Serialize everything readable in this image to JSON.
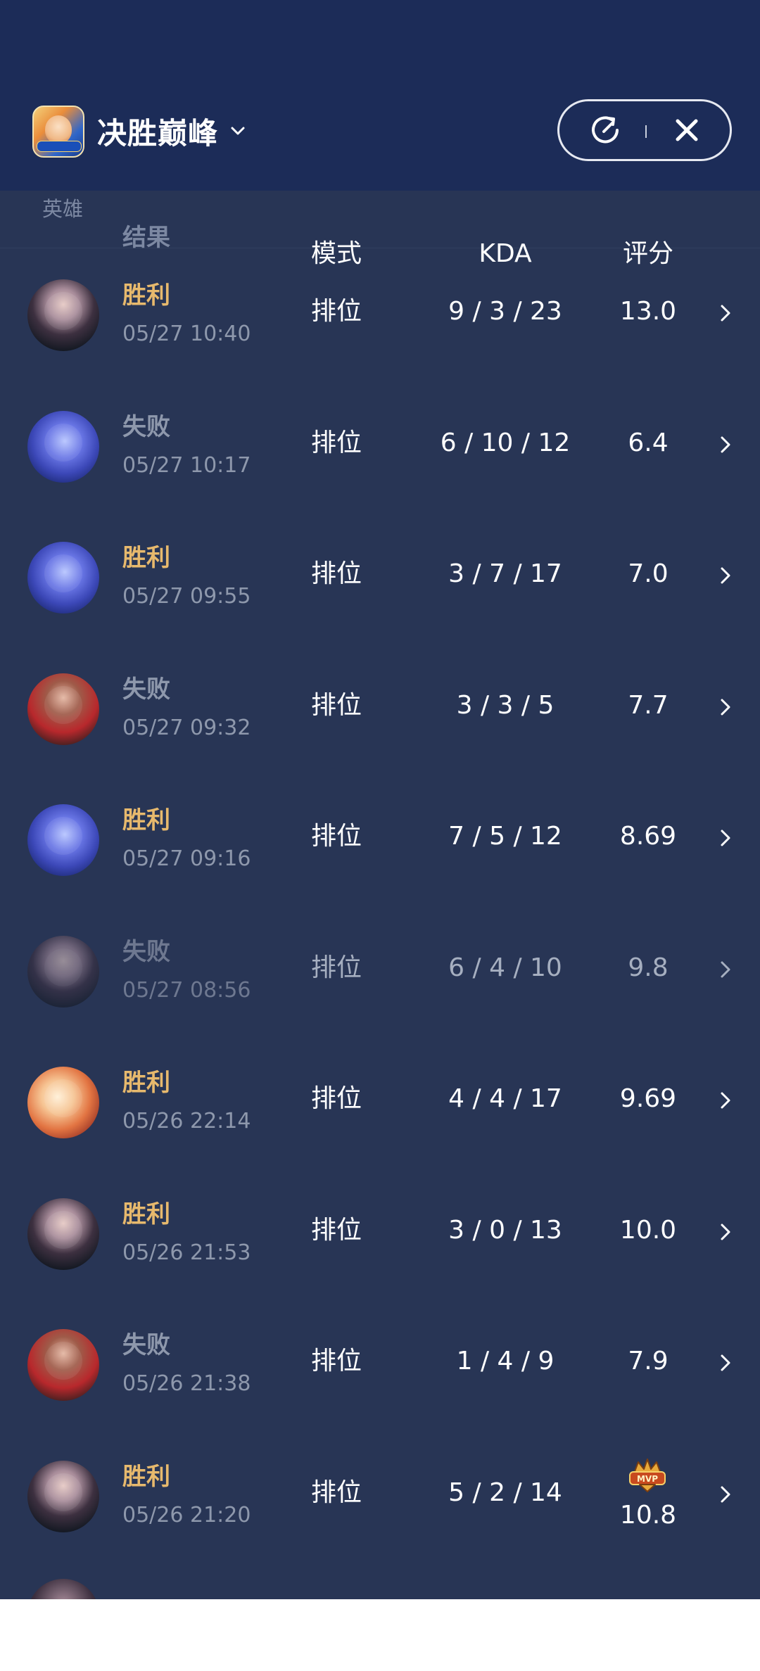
{
  "header": {
    "title": "决胜巅峰",
    "game_icon": "game-logo-icon",
    "background_color": "#1c2c58"
  },
  "table": {
    "columns": [
      "英雄",
      "结果",
      "模式",
      "KDA",
      "评分"
    ],
    "rows": [
      {
        "hero_icon": "hero-dark-haired-icon",
        "result": "胜利",
        "time": "05/27 10:40",
        "mode": "排位",
        "kda": "9 / 3 / 23",
        "score": "13.0"
      },
      {
        "hero_icon": "hero-blue-skin-icon",
        "result": "失败",
        "time": "05/27 10:17",
        "mode": "排位",
        "kda": "6 / 10 / 12",
        "score": "6.4"
      },
      {
        "hero_icon": "hero-blue-skin-icon",
        "result": "胜利",
        "time": "05/27 09:55",
        "mode": "排位",
        "kda": "3 / 7 / 17",
        "score": "7.0"
      },
      {
        "hero_icon": "hero-red-mask-icon",
        "result": "失败",
        "time": "05/27 09:32",
        "mode": "排位",
        "kda": "3 / 3 / 5",
        "score": "7.7"
      },
      {
        "hero_icon": "hero-blue-skin-icon",
        "result": "胜利",
        "time": "05/27 09:16",
        "mode": "排位",
        "kda": "7 / 5 / 12",
        "score": "8.69"
      },
      {
        "hero_icon": "hero-dark-haired-icon",
        "result": "失败",
        "time": "05/27 08:56",
        "mode": "排位",
        "kda": "6 / 4 / 10",
        "score": "9.8"
      },
      {
        "hero_icon": "hero-orange-fire-icon",
        "result": "胜利",
        "time": "05/26 22:14",
        "mode": "排位",
        "kda": "4 / 4 / 17",
        "score": "9.69"
      },
      {
        "hero_icon": "hero-dark-haired-icon",
        "result": "胜利",
        "time": "05/26 21:53",
        "mode": "排位",
        "kda": "3 / 0 / 13",
        "score": "10.0"
      },
      {
        "hero_icon": "hero-red-mask-icon",
        "result": "失败",
        "time": "05/26 21:38",
        "mode": "排位",
        "kda": "1 / 4 / 9",
        "score": "7.9"
      },
      {
        "hero_icon": "hero-dark-haired-icon",
        "result": "胜利",
        "time": "05/26 21:20",
        "mode": "排位",
        "kda": "5 / 2 / 14",
        "score": "10.8",
        "badge": "MVP"
      }
    ]
  },
  "colors": {
    "win": "#e7b96d",
    "loss": "#8e98ac",
    "list_background": "#283555"
  }
}
